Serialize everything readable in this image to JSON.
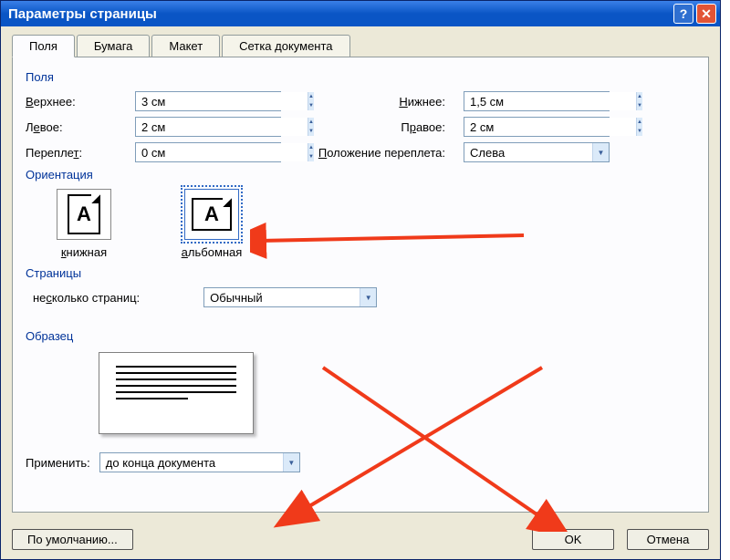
{
  "window": {
    "title": "Параметры страницы"
  },
  "tabs": {
    "t0": "Поля",
    "t1": "Бумага",
    "t2": "Макет",
    "t3": "Сетка документа"
  },
  "groups": {
    "fields": "Поля",
    "orientation": "Ориентация",
    "pages": "Страницы",
    "preview": "Образец"
  },
  "fields": {
    "top_label": "Верхнее:",
    "top_value": "3 см",
    "bottom_label": "Нижнее:",
    "bottom_value": "1,5 см",
    "left_label": "Левое:",
    "left_value": "2 см",
    "right_label": "Правое:",
    "right_value": "2 см",
    "gutter_label": "Переплет:",
    "gutter_value": "0 см",
    "gutter_pos_label": "Положение переплета:",
    "gutter_pos_value": "Слева"
  },
  "orientation": {
    "portrait": "книжная",
    "landscape": "альбомная"
  },
  "pages": {
    "multi_label": "несколько страниц:",
    "multi_value": "Обычный"
  },
  "apply": {
    "label": "Применить:",
    "value": "до конца документа"
  },
  "buttons": {
    "default": "По умолчанию...",
    "ok": "OK",
    "cancel": "Отмена"
  }
}
